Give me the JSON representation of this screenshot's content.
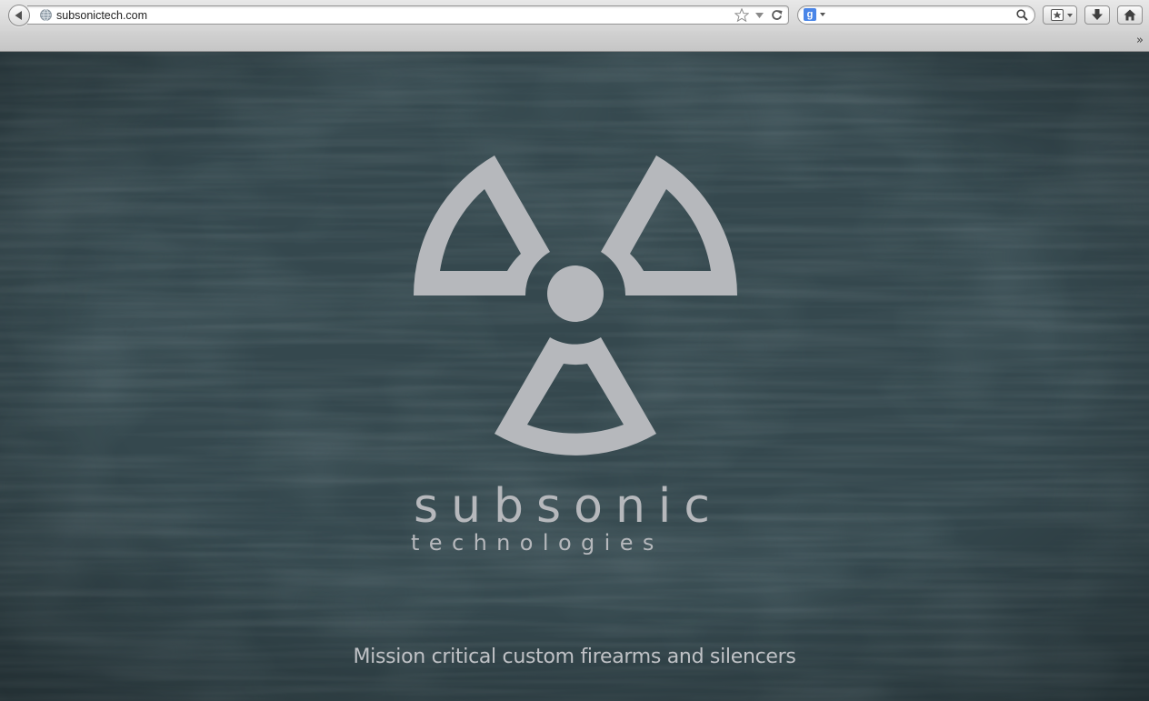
{
  "browser": {
    "url": "subsonictech.com",
    "search_engine_glyph": "g",
    "search_query": "",
    "icons": {
      "back": "back-arrow-icon",
      "site": "globe-icon",
      "bookmark_star": "star-icon",
      "history_dropmark": "dropmark-icon",
      "reload": "reload-icon",
      "search": "search-icon",
      "bookmarks": "bookmarks-icon",
      "downloads": "download-icon",
      "home": "home-icon",
      "overflow": "chevron-double-right-icon"
    },
    "overflow_chevron": "»"
  },
  "page": {
    "logo": {
      "name": "subsonic",
      "subtitle": "technologies",
      "symbol": "radiation-trefoil-icon"
    },
    "tagline": "Mission critical custom firearms and silencers",
    "colors": {
      "background": "#34474d",
      "logo": "#b6b8bc",
      "tagline": "#c0c2c6"
    }
  }
}
